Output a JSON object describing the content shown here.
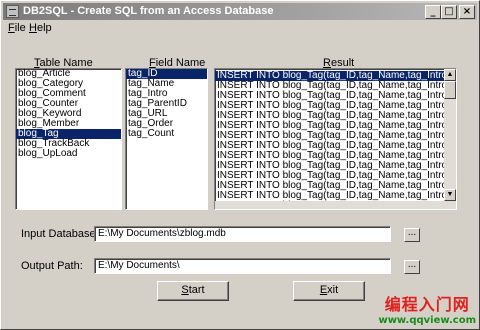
{
  "window": {
    "title": "DB2SQL - Create SQL from an Access Database",
    "minimize_glyph": "_",
    "maximize_glyph": "□",
    "close_glyph": "×"
  },
  "menu": {
    "file": {
      "mnemonic": "F",
      "rest": "ile"
    },
    "help": {
      "mnemonic": "H",
      "rest": "elp"
    }
  },
  "columns": {
    "table_name": {
      "mnemonic": "T",
      "rest": "able Name"
    },
    "field_name": {
      "mnemonic": "F",
      "rest": "ield Name"
    },
    "result": {
      "mnemonic": "R",
      "rest": "esult"
    }
  },
  "tables": {
    "items": [
      "blog_Article",
      "blog_Category",
      "blog_Comment",
      "blog_Counter",
      "blog_Keyword",
      "blog_Member",
      "blog_Tag",
      "blog_TrackBack",
      "blog_UpLoad"
    ],
    "selected": "blog_Tag"
  },
  "fields": {
    "items": [
      "tag_ID",
      "tag_Name",
      "tag_Intro",
      "tag_ParentID",
      "tag_URL",
      "tag_Order",
      "tag_Count"
    ],
    "selected": "tag_ID"
  },
  "results": {
    "items": [
      "INSERT INTO blog_Tag(tag_ID,tag_Name,tag_Intro,tag_Pare",
      "INSERT INTO blog_Tag(tag_ID,tag_Name,tag_Intro,tag_Pare",
      "INSERT INTO blog_Tag(tag_ID,tag_Name,tag_Intro,tag_Pare",
      "INSERT INTO blog_Tag(tag_ID,tag_Name,tag_Intro,tag_Pare",
      "INSERT INTO blog_Tag(tag_ID,tag_Name,tag_Intro,tag_Pare",
      "INSERT INTO blog_Tag(tag_ID,tag_Name,tag_Intro,tag_Pare",
      "INSERT INTO blog_Tag(tag_ID,tag_Name,tag_Intro,tag_Pare",
      "INSERT INTO blog_Tag(tag_ID,tag_Name,tag_Intro,tag_Pare",
      "INSERT INTO blog_Tag(tag_ID,tag_Name,tag_Intro,tag_Pare",
      "INSERT INTO blog_Tag(tag_ID,tag_Name,tag_Intro,tag_Pare",
      "INSERT INTO blog_Tag(tag_ID,tag_Name,tag_Intro,tag_Pare",
      "INSERT INTO blog_Tag(tag_ID,tag_Name,tag_Intro,tag_Pare",
      "INSERT INTO blog_Tag(tag_ID,tag_Name,tag_Intro,tag_Pare",
      "INSERT INTO blog_Tag(tag_ID,tag_Name,tag_Intro,tag_Pare"
    ],
    "selected_index": 0
  },
  "input_database": {
    "label": "Input Database:",
    "value": "E:\\My Documents\\zblog.mdb",
    "browse": "..."
  },
  "output_path": {
    "label": "Output Path:",
    "value": "E:\\My Documents\\",
    "browse": "..."
  },
  "buttons": {
    "start": {
      "mnemonic": "S",
      "rest": "tart"
    },
    "exit": {
      "mnemonic": "E",
      "rest": "xit"
    }
  },
  "watermark": {
    "main": "编程入门网",
    "url": "www.qqview.com"
  },
  "colors": {
    "selection": "#0a246a",
    "window_bg": "#d4d0c8",
    "watermark_red": "#e0201c",
    "watermark_green": "#1a8a1a"
  }
}
